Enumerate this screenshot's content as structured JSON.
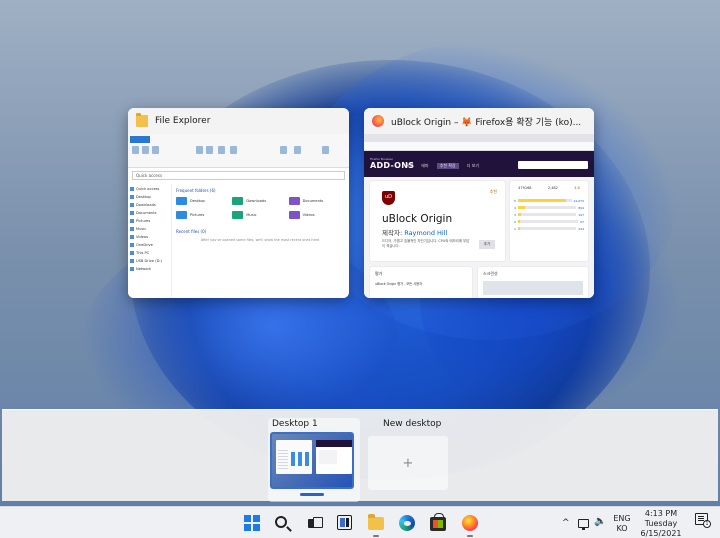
{
  "windows": [
    {
      "title": "File Explorer"
    },
    {
      "title": "uBlock Origin – 🦊 Firefox용 확장 기능 (ko)..."
    }
  ],
  "explorer": {
    "address": "Quick access",
    "nav_items": [
      "Quick access",
      "Desktop",
      "Downloads",
      "Documents",
      "Pictures",
      "Music",
      "Videos",
      "OneDrive",
      "This PC",
      "USB Drive (D:)",
      "Network"
    ],
    "frequent_header": "Frequent folders (6)",
    "folders": [
      {
        "name": "Desktop",
        "sub": "This PC"
      },
      {
        "name": "Downloads",
        "sub": "This PC"
      },
      {
        "name": "Documents",
        "sub": "This PC"
      },
      {
        "name": "Pictures",
        "sub": "This PC"
      },
      {
        "name": "Music",
        "sub": "This PC"
      },
      {
        "name": "Videos",
        "sub": "This PC"
      }
    ],
    "recent_header": "Recent files (0)",
    "recent_empty": "After you've opened some files, we'll show the most recent ones here."
  },
  "addon": {
    "logo_small": "Firefox Browser",
    "logo": "ADD-ONS",
    "nav": [
      "확장",
      "테마",
      "추천 확장",
      "더 보기"
    ],
    "badge": "추천",
    "name": "uBlock Origin",
    "author_label": "제작자: ",
    "author": "Raymond Hill",
    "description": "드디어, 가볍고 효율적인 차단기입니다. CPU와 메모리에 부담이 적습니다.",
    "add_button": "추가",
    "users": "479168",
    "reviews": "2,482",
    "stars": "4.8",
    "ratings": [
      {
        "star": "5",
        "count": "12,670",
        "fill": 0.9
      },
      {
        "star": "4",
        "count": "894",
        "fill": 0.12
      },
      {
        "star": "3",
        "count": "197",
        "fill": 0.05
      },
      {
        "star": "2",
        "count": "97",
        "fill": 0.03
      },
      {
        "star": "1",
        "count": "244",
        "fill": 0.04
      }
    ],
    "section1": "평가",
    "section1_text": "uBlock Origin 평가 - 모든 사용자",
    "section2": "스크린샷"
  },
  "desktops": [
    {
      "label": "Desktop 1"
    },
    {
      "label": "New desktop"
    }
  ],
  "taskbar": {
    "lang_line1": "ENG",
    "lang_line2": "KO",
    "time": "4:13 PM",
    "day": "Tuesday",
    "date": "6/15/2021",
    "notification_count": "1"
  }
}
